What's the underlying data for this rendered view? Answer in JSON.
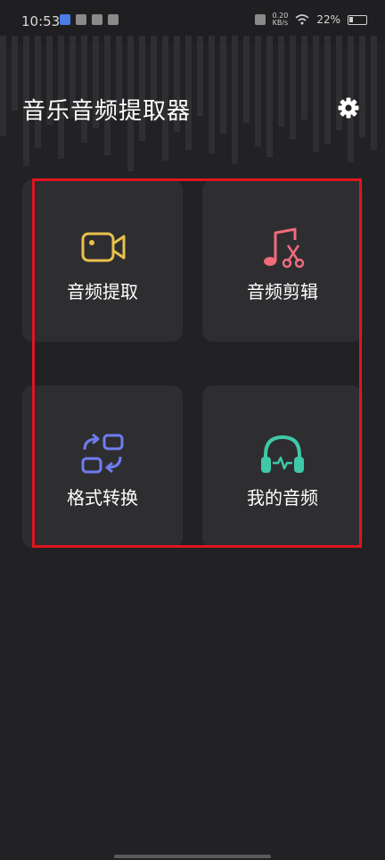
{
  "status": {
    "time": "10:53",
    "speed_value": "0.20",
    "speed_unit": "KB/s",
    "battery": "22%"
  },
  "header": {
    "title": "音乐音频提取器",
    "settings_icon": "gear-icon"
  },
  "tiles": [
    {
      "label": "音频提取",
      "icon": "video-camera-icon",
      "color": "#e8c14d"
    },
    {
      "label": "音频剪辑",
      "icon": "music-scissors-icon",
      "color": "#f06b7b"
    },
    {
      "label": "格式转换",
      "icon": "convert-icon",
      "color": "#6f7cf0"
    },
    {
      "label": "我的音频",
      "icon": "headphones-icon",
      "color": "#3fc9a8"
    }
  ],
  "colors": {
    "background": "#222225",
    "tile": "#2e2e31",
    "highlight": "#e0141e"
  }
}
